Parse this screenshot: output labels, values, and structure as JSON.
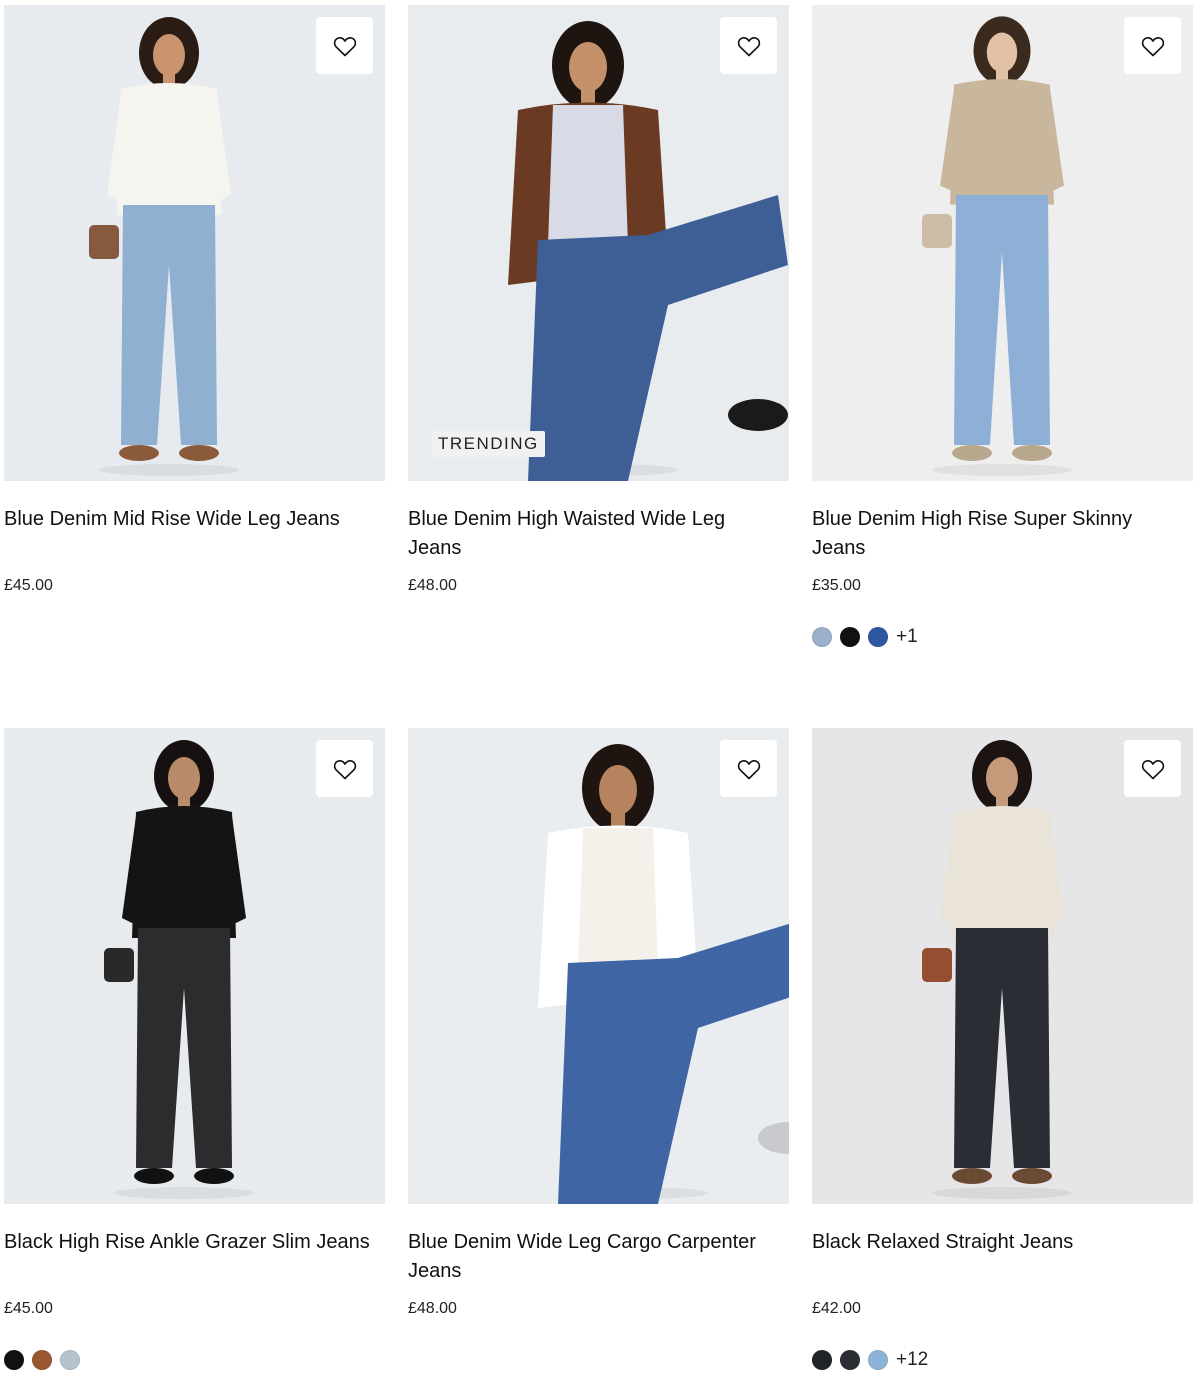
{
  "products": [
    {
      "title": "Blue Denim Mid Rise Wide Leg Jeans",
      "price": "£45.00",
      "badge": "",
      "swatches": [],
      "more": "",
      "photo": {
        "bg": "#e7eaee",
        "top": "#f6f4ef",
        "bottom": "#8fb0d1",
        "skin": "#c9946e",
        "hair": "#2a1c14",
        "shoes": "#8a5a3a",
        "accessory": "#7a4a2a"
      }
    },
    {
      "title": "Blue Denim High Waisted Wide Leg Jeans",
      "price": "£48.00",
      "badge": "TRENDING",
      "swatches": [],
      "more": "",
      "photo": {
        "bg": "#e9ecef",
        "top": "#d8dbe6",
        "bottom": "#3d5f96",
        "skin": "#c4916b",
        "hair": "#1e1410",
        "shoes": "#1a1a1a",
        "accessory": "#6b3a22"
      }
    },
    {
      "title": "Blue Denim High Rise Super Skinny Jeans",
      "price": "£35.00",
      "badge": "",
      "swatches": [
        "#9ab1c9",
        "#111111",
        "#2f56a0"
      ],
      "more": "+1",
      "photo": {
        "bg": "#eeeeee",
        "top": "#c9b79d",
        "bottom": "#8eb0d6",
        "skin": "#e2c2a6",
        "hair": "#3b2a1e",
        "shoes": "#b7a78c",
        "accessory": "#c9b79d"
      }
    },
    {
      "title": "Black High Rise Ankle Grazer Slim Jeans",
      "price": "£45.00",
      "badge": "",
      "swatches": [
        "#111111",
        "#9b5632",
        "#b4c3d0"
      ],
      "more": "",
      "photo": {
        "bg": "#e8ebee",
        "top": "#141414",
        "bottom": "#2c2c2e",
        "skin": "#b88b6a",
        "hair": "#161010",
        "shoes": "#111111",
        "accessory": "#141414"
      }
    },
    {
      "title": "Blue Denim Wide Leg Cargo Carpenter Jeans",
      "price": "£48.00",
      "badge": "",
      "swatches": [],
      "more": "",
      "photo": {
        "bg": "#eaedf0",
        "top": "#f4f1ea",
        "bottom": "#3f65a4",
        "skin": "#b7835f",
        "hair": "#1e1510",
        "shoes": "#c7c9cc",
        "accessory": "#ffffff"
      }
    },
    {
      "title": "Black Relaxed Straight Jeans",
      "price": "£42.00",
      "badge": "",
      "swatches": [
        "#1f2428",
        "#2b2e33",
        "#8fb2d7"
      ],
      "more": "+12",
      "photo": {
        "bg": "#e6e6e8",
        "top": "#e9e3d8",
        "bottom": "#2b2d34",
        "skin": "#c49a7a",
        "hair": "#1c1410",
        "shoes": "#6b4a32",
        "accessory": "#8a3e1c"
      }
    }
  ]
}
